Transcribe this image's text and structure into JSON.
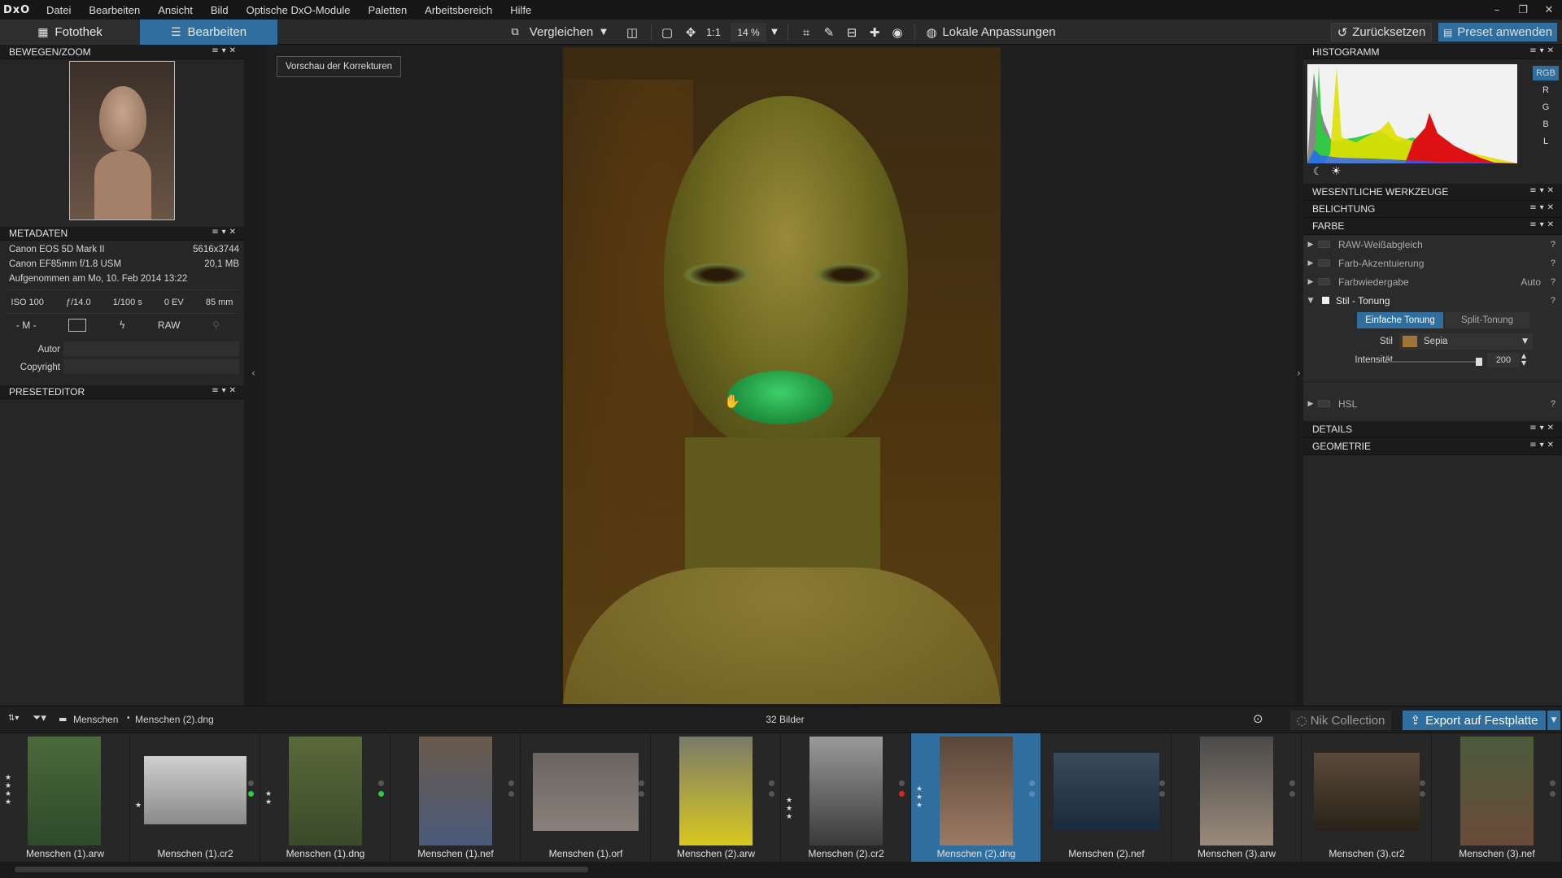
{
  "app": {
    "logo": "DxO",
    "menu": [
      "Datei",
      "Bearbeiten",
      "Ansicht",
      "Bild",
      "Optische DxO-Module",
      "Paletten",
      "Arbeitsbereich",
      "Hilfe"
    ],
    "window_controls": [
      "–",
      "❐",
      "✕"
    ]
  },
  "toolbar": {
    "tab_library": "Fotothek",
    "tab_edit": "Bearbeiten",
    "compare": "Vergleichen",
    "zoom_1to1": "1:1",
    "zoom_level": "14 %",
    "local_adjust": "Lokale Anpassungen",
    "reset": "Zurücksetzen",
    "apply_preset": "Preset anwenden"
  },
  "left": {
    "move_zoom_title": "BEWEGEN/ZOOM",
    "metadata_title": "METADATEN",
    "camera": "Canon EOS 5D Mark II",
    "resolution": "5616x3744",
    "lens": "Canon EF85mm f/1.8 USM",
    "filesize": "20,1 MB",
    "taken": "Aufgenommen am Mo, 10. Feb 2014 13:22",
    "iso": "ISO 100",
    "aperture": "ƒ/14.0",
    "shutter": "1/100 s",
    "ev": "0 EV",
    "focal": "85 mm",
    "mode": "- M -",
    "raw": "RAW",
    "author_label": "Autor",
    "author_value": "",
    "copyright_label": "Copyright",
    "copyright_value": "",
    "preset_editor_title": "PRESETEDITOR"
  },
  "center": {
    "preview_button": "Vorschau der Korrekturen"
  },
  "right": {
    "histogram_title": "HISTOGRAMM",
    "channels": [
      "RGB",
      "R",
      "G",
      "B",
      "L"
    ],
    "essential_tools": "WESENTLICHE WERKZEUGE",
    "exposure": "BELICHTUNG",
    "color": "FARBE",
    "raw_wb": "RAW-Weißabgleich",
    "color_accent": "Farb-Akzentuierung",
    "color_rendering": "Farbwiedergabe",
    "color_rendering_value": "Auto",
    "style_toning": "Stil - Tonung",
    "simple_toning": "Einfache Tonung",
    "split_toning": "Split-Tonung",
    "style_label": "Stil",
    "style_value": "Sepia",
    "style_color": "#a0733a",
    "intensity_label": "Intensität",
    "intensity_value": "200",
    "hsl": "HSL",
    "details": "DETAILS",
    "geometry": "GEOMETRIE",
    "help": "?"
  },
  "filmstrip": {
    "folder": "Menschen",
    "file": "Menschen (2).dng",
    "count": "32 Bilder",
    "nik": "Nik Collection",
    "export": "Export auf Festplatte",
    "thumbs": [
      {
        "name": "Menschen (1).arw"
      },
      {
        "name": "Menschen (1).cr2"
      },
      {
        "name": "Menschen (1).dng"
      },
      {
        "name": "Menschen (1).nef"
      },
      {
        "name": "Menschen (1).orf"
      },
      {
        "name": "Menschen (2).arw"
      },
      {
        "name": "Menschen (2).cr2"
      },
      {
        "name": "Menschen (2).dng"
      },
      {
        "name": "Menschen (2).nef"
      },
      {
        "name": "Menschen (3).arw"
      },
      {
        "name": "Menschen (3).cr2"
      },
      {
        "name": "Menschen (3).nef"
      }
    ]
  },
  "colors": {
    "accent": "#2f6e9e",
    "panel": "#262626",
    "toning_tint": "#7a6a1e"
  }
}
